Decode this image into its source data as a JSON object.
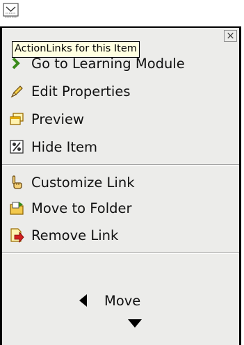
{
  "tooltip": {
    "text": "ActionLinks for this Item"
  },
  "close": {
    "label": "×"
  },
  "menu": {
    "items": [
      {
        "label": "Go to Learning Module",
        "icon": "green-chevron-icon"
      },
      {
        "label": "Edit Properties",
        "icon": "pencil-icon"
      },
      {
        "label": "Preview",
        "icon": "preview-window-icon"
      },
      {
        "label": "Hide Item",
        "icon": "hide-item-icon"
      },
      {
        "label": "Customize Link",
        "icon": "hand-pointer-icon"
      },
      {
        "label": "Move to Folder",
        "icon": "folder-move-icon"
      },
      {
        "label": "Remove Link",
        "icon": "remove-link-icon"
      }
    ]
  },
  "move": {
    "label": "Move"
  },
  "colors": {
    "panel": "#ececea",
    "tooltip_bg": "#ffffe1",
    "chevron": "#3a8a1a"
  }
}
